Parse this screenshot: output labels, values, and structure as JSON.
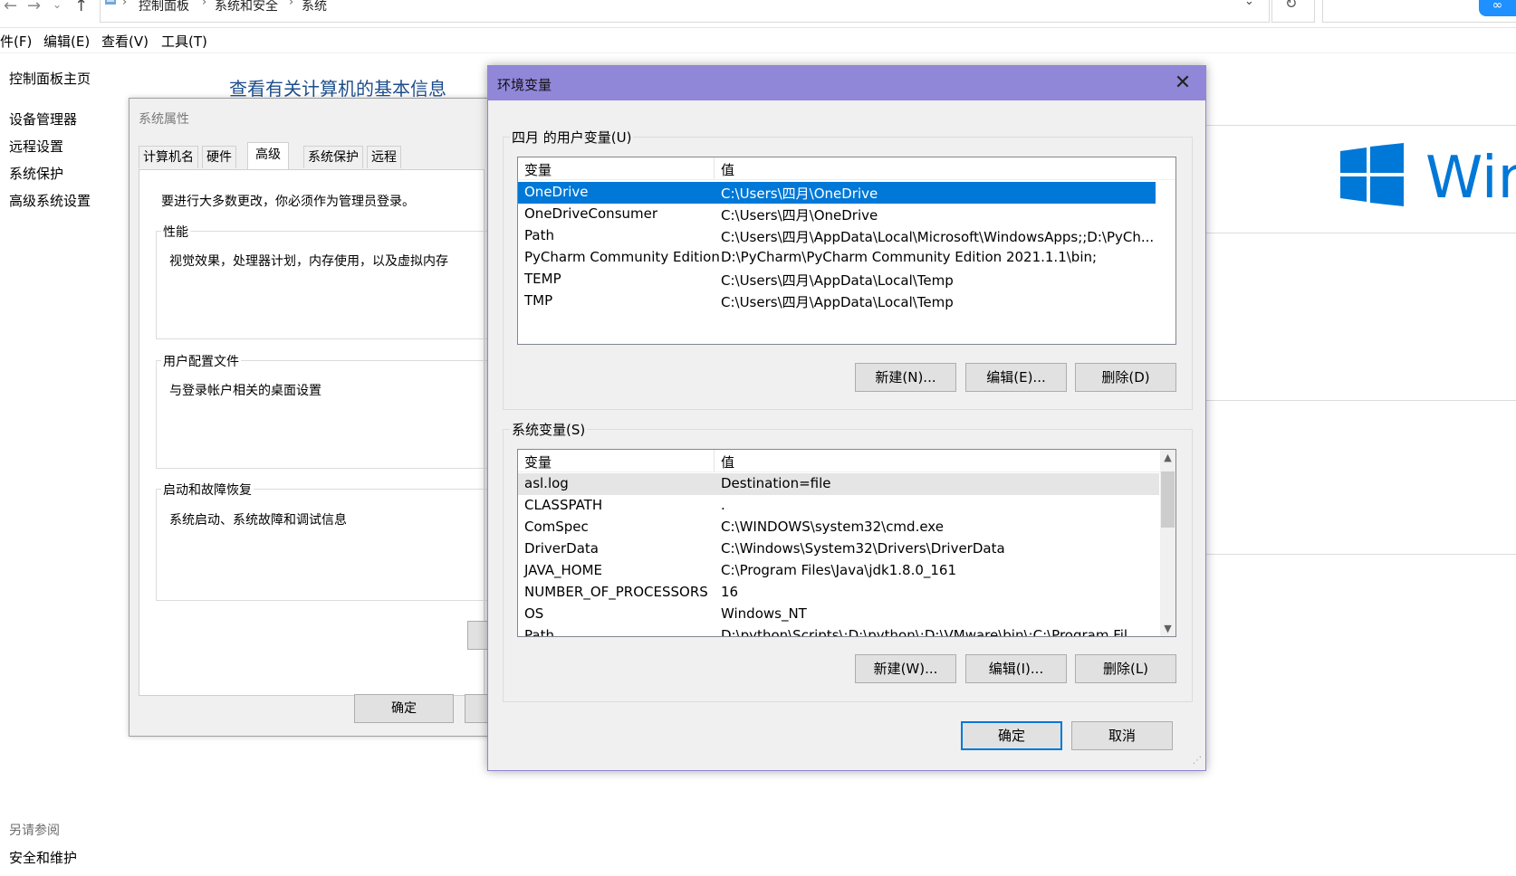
{
  "explorer": {
    "breadcrumb": [
      "控制面板",
      "系统和安全",
      "系统"
    ],
    "menu": [
      "件(F)",
      "编辑(E)",
      "查看(V)",
      "工具(T)"
    ],
    "sidebar_home": "控制面板主页",
    "sidebar_links": [
      "设备管理器",
      "远程设置",
      "系统保护",
      "高级系统设置"
    ],
    "see_also_title": "另请参阅",
    "see_also_link": "安全和维护",
    "heading": "查看有关计算机的基本信息",
    "win_text": "Win",
    "cloud_badge": "∞"
  },
  "sysprops": {
    "title": "系统属性",
    "tabs": [
      "计算机名",
      "硬件",
      "高级",
      "系统保护",
      "远程"
    ],
    "active_tab": "高级",
    "admin_note": "要进行大多数更改，你必须作为管理员登录。",
    "groups": [
      {
        "label": "性能",
        "desc": "视觉效果，处理器计划，内存使用，以及虚拟内存"
      },
      {
        "label": "用户配置文件",
        "desc": "与登录帐户相关的桌面设置"
      },
      {
        "label": "启动和故障恢复",
        "desc": "系统启动、系统故障和调试信息"
      }
    ],
    "ok_label": "确定"
  },
  "env": {
    "title": "环境变量",
    "close_glyph": "✕",
    "user_section_label": "四月 的用户变量(U)",
    "system_section_label": "系统变量(S)",
    "col_var": "变量",
    "col_val": "值",
    "user_vars": [
      {
        "name": "OneDrive",
        "value": "C:\\Users\\四月\\OneDrive"
      },
      {
        "name": "OneDriveConsumer",
        "value": "C:\\Users\\四月\\OneDrive"
      },
      {
        "name": "Path",
        "value": "C:\\Users\\四月\\AppData\\Local\\Microsoft\\WindowsApps;;D:\\PyCh..."
      },
      {
        "name": "PyCharm Community Edition",
        "value": "D:\\PyCharm\\PyCharm Community Edition 2021.1.1\\bin;"
      },
      {
        "name": "TEMP",
        "value": "C:\\Users\\四月\\AppData\\Local\\Temp"
      },
      {
        "name": "TMP",
        "value": "C:\\Users\\四月\\AppData\\Local\\Temp"
      }
    ],
    "system_vars": [
      {
        "name": "asl.log",
        "value": "Destination=file"
      },
      {
        "name": "CLASSPATH",
        "value": "."
      },
      {
        "name": "ComSpec",
        "value": "C:\\WINDOWS\\system32\\cmd.exe"
      },
      {
        "name": "DriverData",
        "value": "C:\\Windows\\System32\\Drivers\\DriverData"
      },
      {
        "name": "JAVA_HOME",
        "value": "C:\\Program Files\\Java\\jdk1.8.0_161"
      },
      {
        "name": "NUMBER_OF_PROCESSORS",
        "value": "16"
      },
      {
        "name": "OS",
        "value": "Windows_NT"
      },
      {
        "name": "Path",
        "value": "D:\\python\\Scripts\\;D:\\python\\;D:\\VMware\\bin\\;C:\\Program Fil..."
      }
    ],
    "user_buttons": {
      "new": "新建(N)...",
      "edit": "编辑(E)...",
      "delete": "删除(D)"
    },
    "system_buttons": {
      "new": "新建(W)...",
      "edit": "编辑(I)...",
      "delete": "删除(L)"
    },
    "ok": "确定",
    "cancel": "取消"
  }
}
